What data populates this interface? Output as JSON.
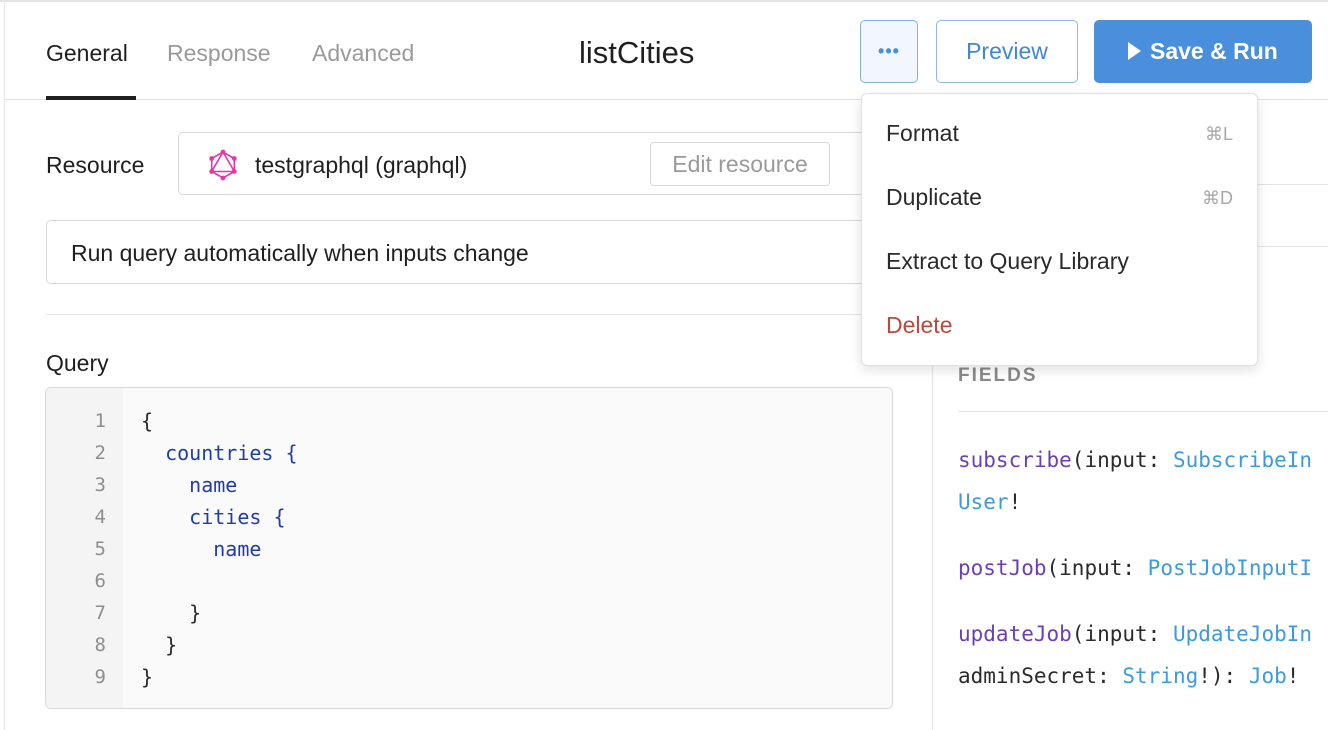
{
  "header": {
    "tabs": [
      {
        "label": "General",
        "active": true
      },
      {
        "label": "Response",
        "active": false
      },
      {
        "label": "Advanced",
        "active": false
      }
    ],
    "title": "listCities",
    "more_label": "•••",
    "preview_label": "Preview",
    "run_label": "Save & Run"
  },
  "resource": {
    "label": "Resource",
    "value": "testgraphql (graphql)",
    "edit_label": "Edit resource",
    "icon": "graphql-icon"
  },
  "run_mode": {
    "value": "Run query automatically when inputs change"
  },
  "query": {
    "label": "Query",
    "lines": [
      {
        "no": "1",
        "text": "{"
      },
      {
        "no": "2",
        "text": "  countries {"
      },
      {
        "no": "3",
        "text": "    name"
      },
      {
        "no": "4",
        "text": "    cities {"
      },
      {
        "no": "5",
        "text": "      name"
      },
      {
        "no": "6",
        "text": ""
      },
      {
        "no": "7",
        "text": "    }"
      },
      {
        "no": "8",
        "text": "  }"
      },
      {
        "no": "9",
        "text": "}"
      }
    ]
  },
  "schema": {
    "fields_label": "FIELDS",
    "items": [
      {
        "fn": "subscribe",
        "p1": "(input: ",
        "t1": "SubscribeIn"
      },
      {
        "t2": "User",
        "p2": "!"
      },
      {
        "fn": "postJob",
        "p1": "(input: ",
        "t1": "PostJobInputI"
      },
      {
        "fn": "updateJob",
        "p1": "(input: ",
        "t1": "UpdateJobIn"
      },
      {
        "p1": "adminSecret: ",
        "t1": "String",
        "p2": "!): ",
        "t2": "Job",
        "p3": "!"
      }
    ]
  },
  "menu": {
    "items": [
      {
        "label": "Format",
        "shortcut": "⌘L"
      },
      {
        "label": "Duplicate",
        "shortcut": "⌘D"
      },
      {
        "label": "Extract to Query Library",
        "shortcut": ""
      },
      {
        "label": "Delete",
        "shortcut": ""
      }
    ]
  },
  "colors": {
    "accent": "#4a8fdb",
    "danger": "#c0473a",
    "graphql": "#e535ab"
  }
}
